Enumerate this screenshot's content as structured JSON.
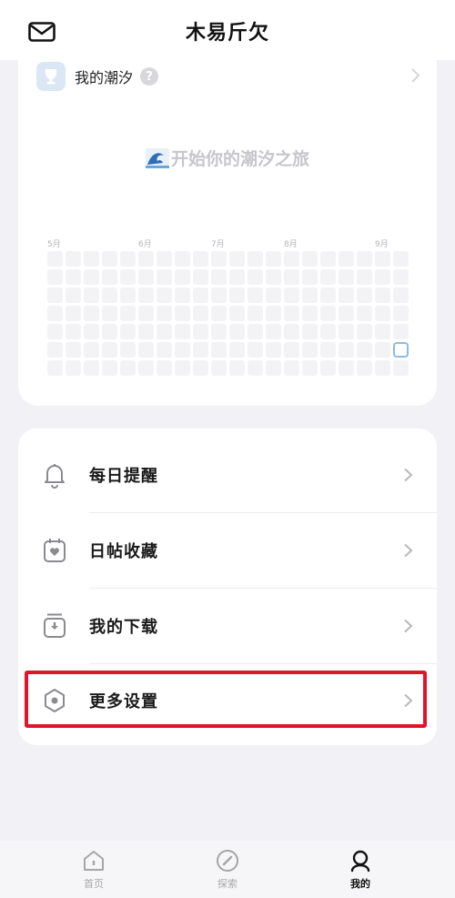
{
  "header": {
    "title": "木易斤欠"
  },
  "tide": {
    "title": "我的潮汐",
    "help": "?",
    "empty_text": "开始你的潮汐之旅",
    "months": [
      "5月",
      "6月",
      "7月",
      "8月",
      "9月"
    ]
  },
  "menu": {
    "items": [
      {
        "label": "每日提醒"
      },
      {
        "label": "日帖收藏"
      },
      {
        "label": "我的下载"
      },
      {
        "label": "更多设置"
      }
    ]
  },
  "tabbar": {
    "tabs": [
      {
        "label": "首页"
      },
      {
        "label": "探索"
      },
      {
        "label": "我的"
      }
    ]
  }
}
